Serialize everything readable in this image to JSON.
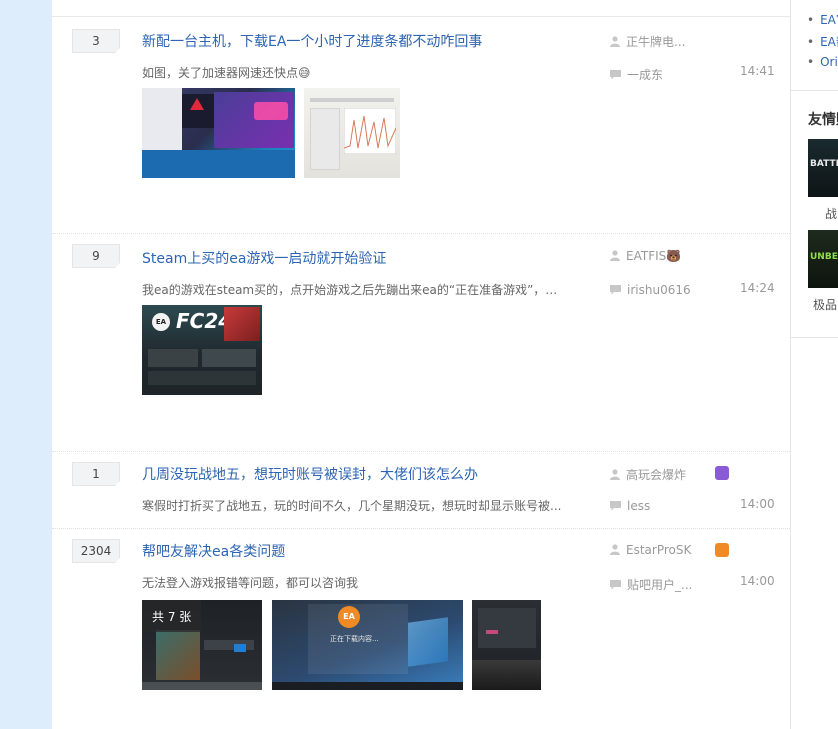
{
  "sidebar": {
    "links": [
      "EA官",
      "EA帮",
      "Origi"
    ],
    "friends_title": "友情贴吧",
    "friends": [
      {
        "label": "BATTLE",
        "caption": "战"
      },
      {
        "label": "UNBE",
        "caption": "极品"
      }
    ]
  },
  "threads": [
    {
      "reply_count": "3",
      "title": "新配一台主机，下载EA一个小时了进度条都不动咋回事",
      "excerpt": "如图，关了加速器网速还快点😅",
      "author": "正牛牌电...",
      "last_reply": "一成东",
      "time": "14:41",
      "images": [
        {
          "overlay": "",
          "desc": "screen-photo-1"
        },
        {
          "overlay": "",
          "desc": "screen-photo-2"
        }
      ]
    },
    {
      "reply_count": "9",
      "title": "Steam上买的ea游戏一启动就开始验证",
      "excerpt": "我ea的游戏在steam买的，点开始游戏之后先蹦出来ea的“正在准备游戏”，然...",
      "author": "EATFIS🐻",
      "last_reply": "irishu0616",
      "time": "14:24",
      "images": [
        {
          "overlay": "",
          "fc_text": "FC24",
          "ea_text": "EA"
        }
      ]
    },
    {
      "reply_count": "1",
      "title": "几周没玩战地五，想玩时账号被误封，大佬们该怎么办",
      "excerpt": "寒假时打折买了战地五，玩的时间不久，几个星期没玩，想玩时却显示账号被...",
      "author": "高玩会爆炸",
      "last_reply": "less",
      "time": "14:00",
      "badge_color": "#8a5bd6",
      "images": []
    },
    {
      "reply_count": "2304",
      "title": "帮吧友解决ea各类问题",
      "excerpt": "无法登入游戏报错等问题，都可以咨询我",
      "author": "EstarProSK",
      "last_reply": "贴吧用户_...",
      "time": "14:00",
      "badge_color": "#f08a24",
      "images": [
        {
          "overlay": "共 7 张"
        },
        {
          "overlay": "",
          "ea_text": "EA",
          "loading_text": "正在下载内容..."
        },
        {
          "overlay": ""
        }
      ]
    }
  ]
}
